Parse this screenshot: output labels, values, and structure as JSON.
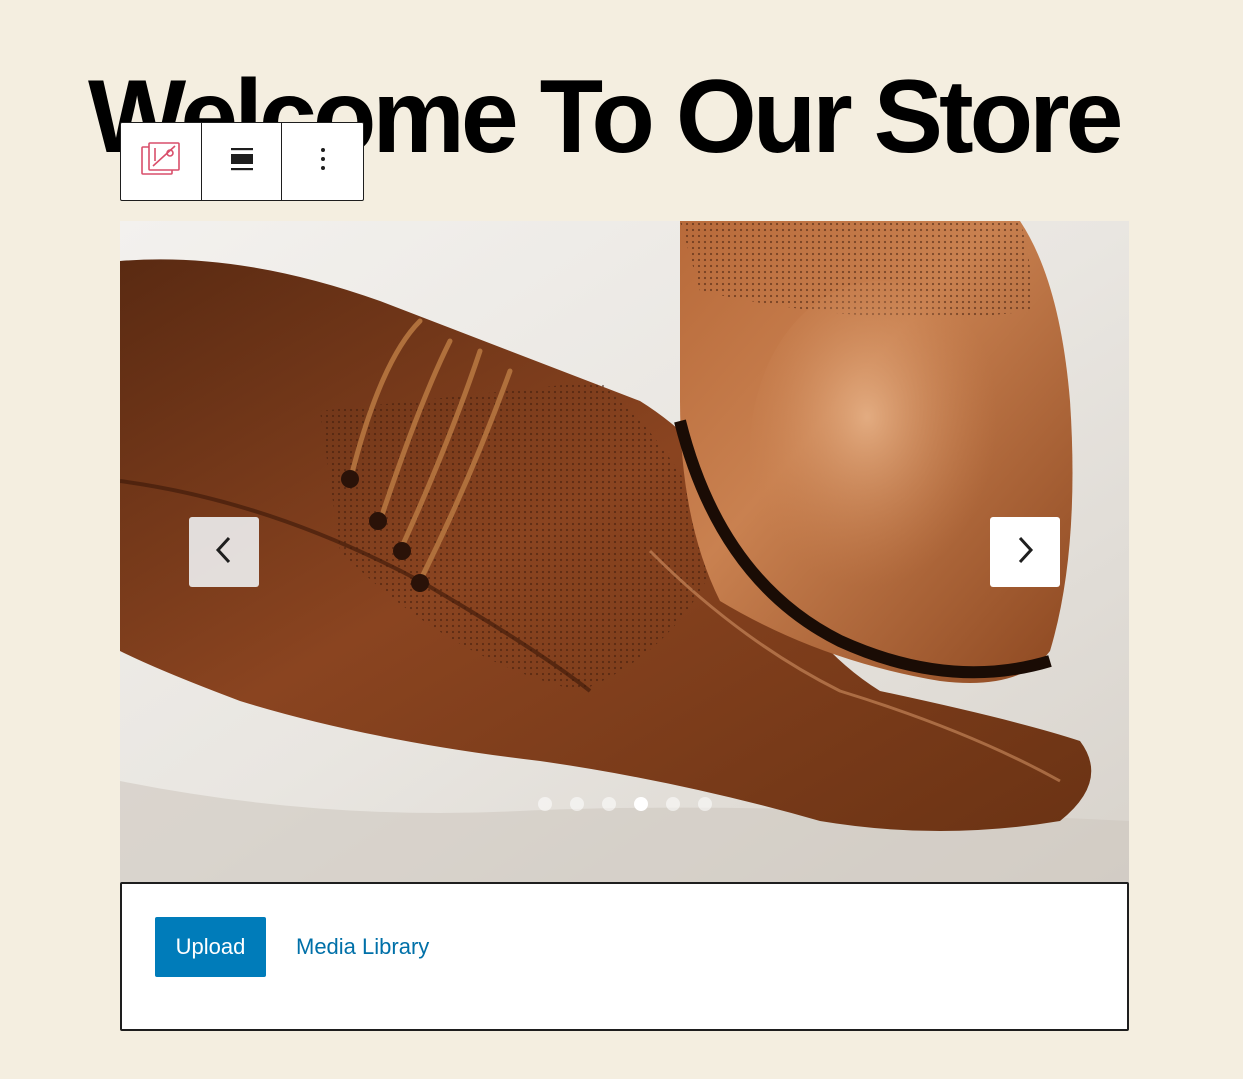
{
  "page": {
    "title": "Welcome To Our Store"
  },
  "toolbar": {
    "items": [
      {
        "name": "slider-block-icon"
      },
      {
        "name": "align-icon"
      },
      {
        "name": "more-options-icon"
      }
    ]
  },
  "slider": {
    "image_subject": "Pair of brown leather dress shoes on white cloth",
    "slide_count": 6,
    "active_slide_index": 3,
    "prev_icon": "chevron-left-icon",
    "next_icon": "chevron-right-icon"
  },
  "upload": {
    "upload_label": "Upload",
    "media_library_label": "Media Library"
  },
  "colors": {
    "background": "#f4eee0",
    "accent": "#007cba",
    "link": "#0070a8",
    "slider_icon": "#d94f6b"
  }
}
